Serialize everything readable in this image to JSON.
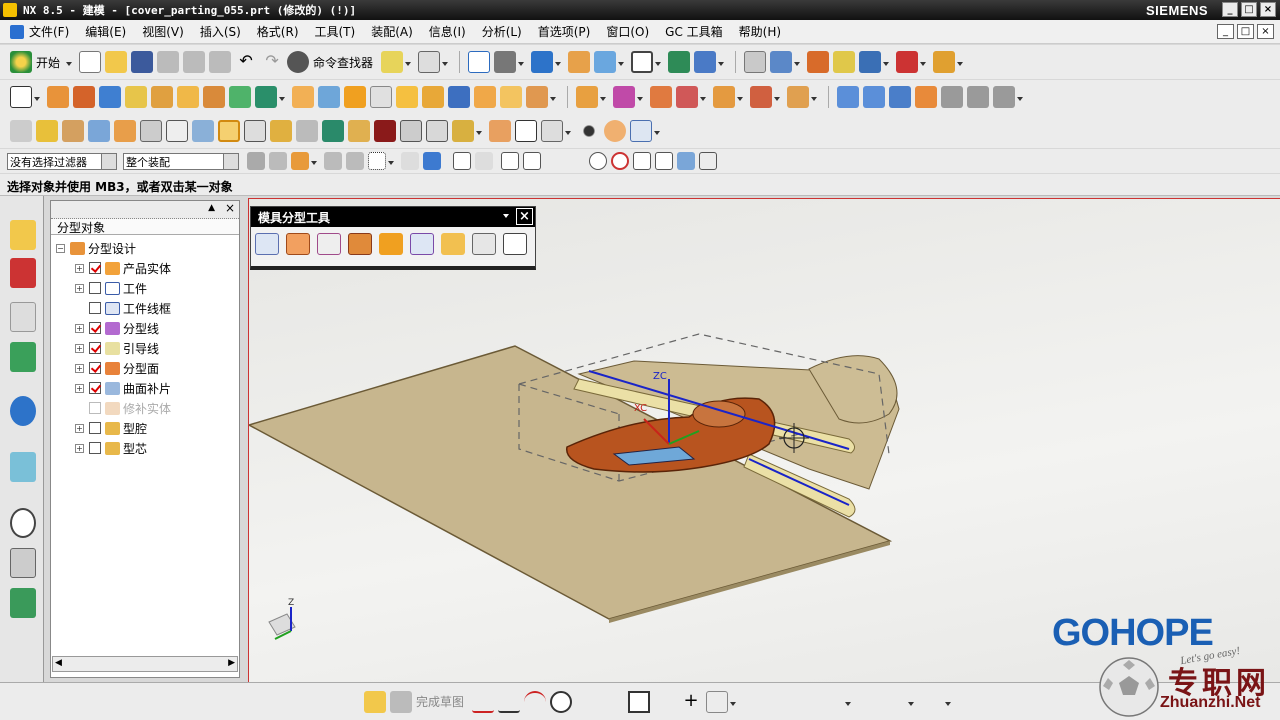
{
  "window": {
    "title": "NX 8.5 - 建模 - [cover_parting_055.prt (修改的)     (!)]",
    "brand": "SIEMENS",
    "controls": [
      "_",
      "□",
      "×"
    ]
  },
  "menu": {
    "items": [
      "文件(F)",
      "编辑(E)",
      "视图(V)",
      "插入(S)",
      "格式(R)",
      "工具(T)",
      "装配(A)",
      "信息(I)",
      "分析(L)",
      "首选项(P)",
      "窗口(O)",
      "GC 工具箱",
      "帮助(H)"
    ],
    "doc_controls": [
      "_",
      "□",
      "×"
    ]
  },
  "toolbar": {
    "start_label": "开始",
    "command_finder_label": "命令查找器"
  },
  "filter_bar": {
    "type_filter": "没有选择过滤器",
    "scope_filter": "整个装配"
  },
  "prompt": "选择对象并使用 MB3，或者双击某一对象",
  "tree": {
    "column_header": "分型对象",
    "root": "分型设计",
    "nodes": [
      {
        "label": "产品实体",
        "checked": true,
        "expandable": true,
        "enabled": true,
        "icon": "solid-body-icon"
      },
      {
        "label": "工件",
        "checked": false,
        "expandable": true,
        "enabled": true,
        "icon": "workpiece-icon"
      },
      {
        "label": "工件线框",
        "checked": false,
        "expandable": false,
        "enabled": true,
        "icon": "wireframe-icon"
      },
      {
        "label": "分型线",
        "checked": true,
        "expandable": true,
        "enabled": true,
        "icon": "parting-line-icon"
      },
      {
        "label": "引导线",
        "checked": true,
        "expandable": true,
        "enabled": true,
        "icon": "guide-line-icon"
      },
      {
        "label": "分型面",
        "checked": true,
        "expandable": true,
        "enabled": true,
        "icon": "parting-surface-icon"
      },
      {
        "label": "曲面补片",
        "checked": true,
        "expandable": true,
        "enabled": true,
        "icon": "surface-patch-icon"
      },
      {
        "label": "修补实体",
        "checked": false,
        "expandable": false,
        "enabled": false,
        "icon": "patch-solid-icon"
      },
      {
        "label": "型腔",
        "checked": false,
        "expandable": true,
        "enabled": true,
        "icon": "cavity-icon"
      },
      {
        "label": "型芯",
        "checked": false,
        "expandable": true,
        "enabled": true,
        "icon": "core-icon"
      }
    ]
  },
  "palette": {
    "title": "模具分型工具",
    "close": "×"
  },
  "viewport": {
    "axis_labels": {
      "zc": "ZC",
      "xc": "XC",
      "triad_z": "Z"
    }
  },
  "sketch_bar": {
    "finish_sketch_label": "完成草图"
  },
  "watermark": {
    "brand": "GOHOPE",
    "tagline": "Let's go easy!",
    "site_cn": "专职网",
    "site_url": "Zhuanzhi.Net"
  },
  "colors": {
    "sheet": "#c7b68e",
    "part": "#b8541f",
    "highlight": "#e0cd56",
    "accent_blue": "#1a5fb4",
    "watermark_red": "#7a1416"
  }
}
